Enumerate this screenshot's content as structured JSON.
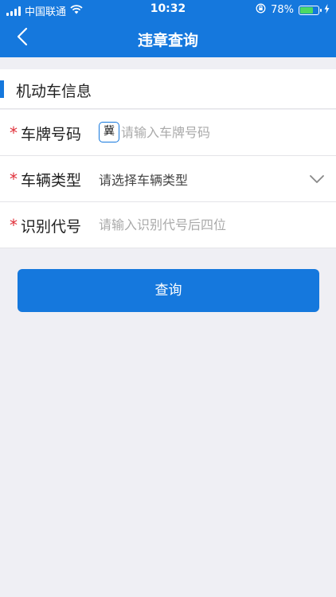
{
  "status_bar": {
    "carrier": "中国联通",
    "time": "10:32",
    "battery_percent": "78%",
    "battery_level": 0.78,
    "icons": [
      "signal-icon",
      "wifi-icon",
      "rotation-lock-icon",
      "battery-icon",
      "charging-icon"
    ]
  },
  "nav": {
    "title": "违章查询",
    "back_icon": "chevron-left-icon"
  },
  "section": {
    "title": "机动车信息"
  },
  "form": {
    "required_mark": "*",
    "plate": {
      "label": "车牌号码",
      "prefix": "冀",
      "placeholder": "请输入车牌号码"
    },
    "vehicle_type": {
      "label": "车辆类型",
      "placeholder": "请选择车辆类型",
      "icon": "chevron-down-icon"
    },
    "vin": {
      "label": "识别代号",
      "placeholder": "请输入识别代号后四位"
    }
  },
  "actions": {
    "query_label": "查询"
  },
  "colors": {
    "primary": "#1578dd",
    "required": "#e0303a",
    "background": "#efeff4",
    "battery_fill": "#4cd964"
  }
}
